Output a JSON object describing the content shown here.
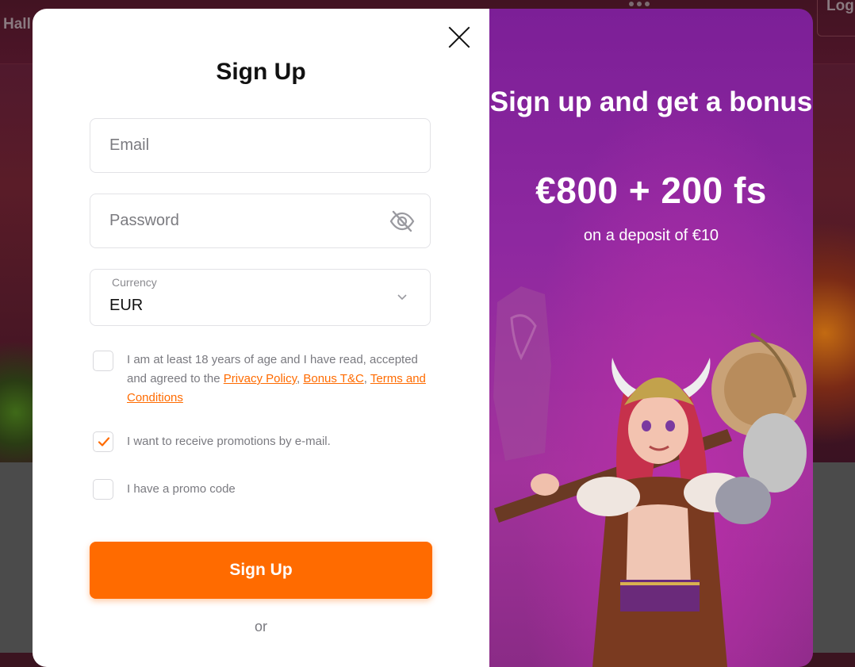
{
  "background": {
    "header_left_text": "Hall",
    "header_right_text": "Log"
  },
  "signup_modal": {
    "title": "Sign Up",
    "email": {
      "placeholder": "Email",
      "value": ""
    },
    "password": {
      "placeholder": "Password",
      "value": ""
    },
    "currency": {
      "label": "Currency",
      "value": "EUR"
    },
    "age_consent": {
      "checked": false,
      "text_before": "I am at least 18 years of age and I have read, accepted and agreed to the ",
      "link_privacy": "Privacy Policy",
      "sep1": ", ",
      "link_bonus": "Bonus T&C",
      "sep2": ", ",
      "link_terms": "Terms and Conditions"
    },
    "promotions_consent": {
      "checked": true,
      "text": "I want to receive promotions by e-mail."
    },
    "promo_code": {
      "checked": false,
      "text": "I have a promo code"
    },
    "submit_label": "Sign Up",
    "or_text": "or"
  },
  "promo_panel": {
    "headline": "Sign up and get a bonus",
    "amount": "€800 + 200 fs",
    "subtext": "on a deposit of €10"
  },
  "colors": {
    "accent": "#ff6b00",
    "promo_bg_top": "#7c1f97",
    "promo_bg_bottom": "#a2329c"
  }
}
